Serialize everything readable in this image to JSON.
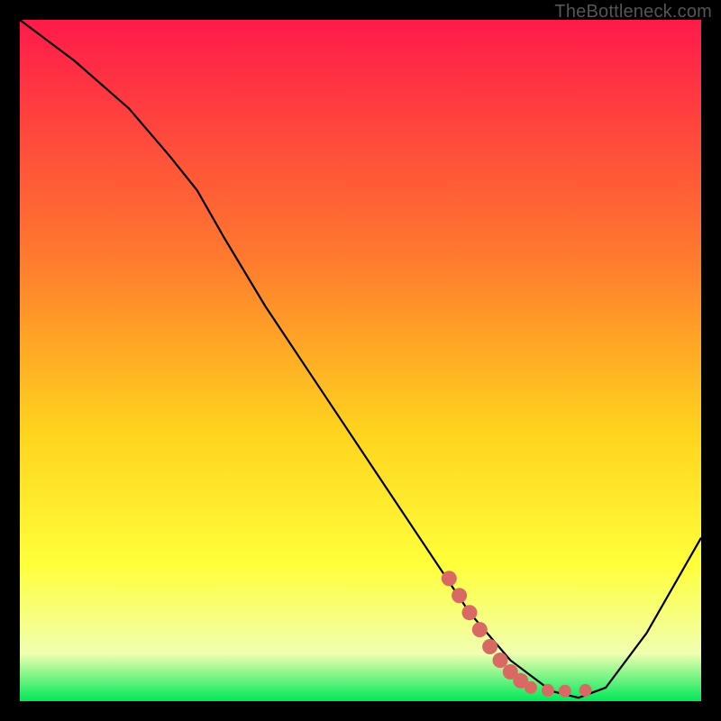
{
  "watermark": "TheBottleneck.com",
  "colors": {
    "curve": "#000000",
    "marker": "#d96a63",
    "gradient_top": "#ff1a4a",
    "gradient_mid1": "#ff7a2e",
    "gradient_mid2": "#ffd21e",
    "gradient_mid3": "#ffff3a",
    "gradient_mid4": "#f0ffb0",
    "gradient_bottom": "#00e85a"
  },
  "chart_data": {
    "type": "line",
    "title": "",
    "xlabel": "",
    "ylabel": "",
    "xlim": [
      0,
      100
    ],
    "ylim": [
      0,
      100
    ],
    "curve": [
      {
        "x": 0,
        "y": 100
      },
      {
        "x": 8,
        "y": 94
      },
      {
        "x": 16,
        "y": 87
      },
      {
        "x": 22,
        "y": 80
      },
      {
        "x": 26,
        "y": 75
      },
      {
        "x": 30,
        "y": 68
      },
      {
        "x": 36,
        "y": 58
      },
      {
        "x": 44,
        "y": 46
      },
      {
        "x": 52,
        "y": 34
      },
      {
        "x": 60,
        "y": 22
      },
      {
        "x": 66,
        "y": 13
      },
      {
        "x": 72,
        "y": 6
      },
      {
        "x": 78,
        "y": 1.5
      },
      {
        "x": 82,
        "y": 0.5
      },
      {
        "x": 86,
        "y": 2
      },
      {
        "x": 92,
        "y": 10
      },
      {
        "x": 100,
        "y": 24
      }
    ],
    "markers": [
      {
        "x": 63,
        "y": 18
      },
      {
        "x": 64.5,
        "y": 15.5
      },
      {
        "x": 66,
        "y": 13
      },
      {
        "x": 67.5,
        "y": 10.5
      },
      {
        "x": 69,
        "y": 8
      },
      {
        "x": 70.5,
        "y": 6
      },
      {
        "x": 72,
        "y": 4.3
      },
      {
        "x": 73.5,
        "y": 3
      },
      {
        "x": 75,
        "y": 2
      },
      {
        "x": 77.5,
        "y": 1.6
      },
      {
        "x": 80,
        "y": 1.5
      },
      {
        "x": 83,
        "y": 1.6
      }
    ]
  }
}
